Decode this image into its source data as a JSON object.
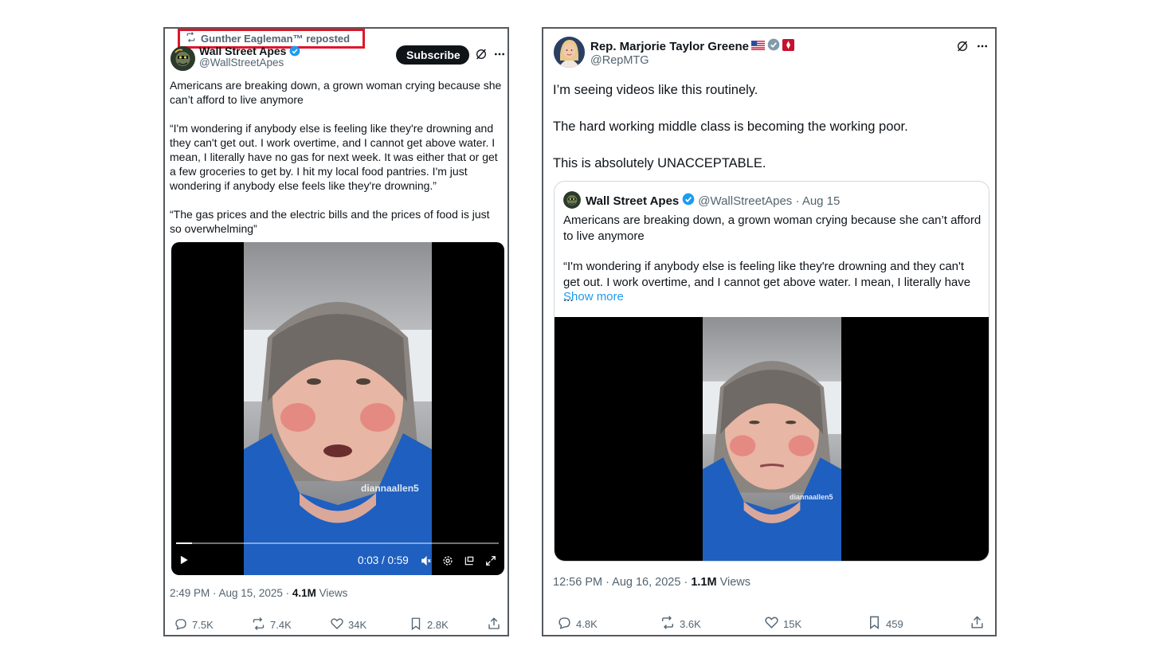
{
  "left_tweet": {
    "repost_label": "Gunther Eagleman™ reposted",
    "author_name": "Wall Street Apes",
    "author_handle": "@WallStreetApes",
    "subscribe_label": "Subscribe",
    "text_paragraphs": [
      "Americans are breaking down, a grown woman crying because she can’t afford to live anymore",
      "“I'm wondering if anybody else is feeling like they're drowning and they can't get out. I work overtime, and I cannot get above water. I mean, I literally have no gas for next week. It was either that or get a few groceries to get by. I hit my local food pantries. I'm just wondering if anybody else feels like they're drowning.”",
      "“The gas prices and the electric bills and the prices of food is just so overwhelming”"
    ],
    "video": {
      "watermark": "diannaallen5",
      "time": "0:03 / 0:59",
      "progress": 0.05
    },
    "timestamp": "2:49 PM · Aug 15, 2025 · ",
    "views_count": "4.1M",
    "views_label": " Views",
    "stats": {
      "replies": "7.5K",
      "reposts": "7.4K",
      "likes": "34K",
      "bookmarks": "2.8K"
    }
  },
  "right_tweet": {
    "author_name": "Rep. Marjorie Taylor Greene",
    "author_handle": "@RepMTG",
    "text_paragraphs": [
      "I’m seeing videos like this routinely.",
      "The hard working middle class is becoming the working poor.",
      "This is absolutely UNACCEPTABLE."
    ],
    "quote": {
      "author_name": "Wall Street Apes",
      "author_handle_date": "@WallStreetApes · Aug 15",
      "text_paragraphs": [
        "Americans are breaking down, a grown woman crying because she can’t afford to live anymore",
        "“I'm wondering if anybody else is feeling like they're drowning and they can't get out. I work overtime, and I cannot get above water. I mean, I literally have ..."
      ],
      "show_more": "Show more",
      "watermark": "diannaallen5"
    },
    "timestamp": "12:56 PM · Aug 16, 2025 · ",
    "views_count": "1.1M",
    "views_label": " Views",
    "stats": {
      "replies": "4.8K",
      "reposts": "3.6K",
      "likes": "15K",
      "bookmarks": "459"
    }
  },
  "colors": {
    "verified": "#1d9bf0",
    "highlight_box": "#e0162b",
    "muted_text": "#536471",
    "video_bg": "#000000",
    "scrub_blue": "#2a6ecf"
  }
}
